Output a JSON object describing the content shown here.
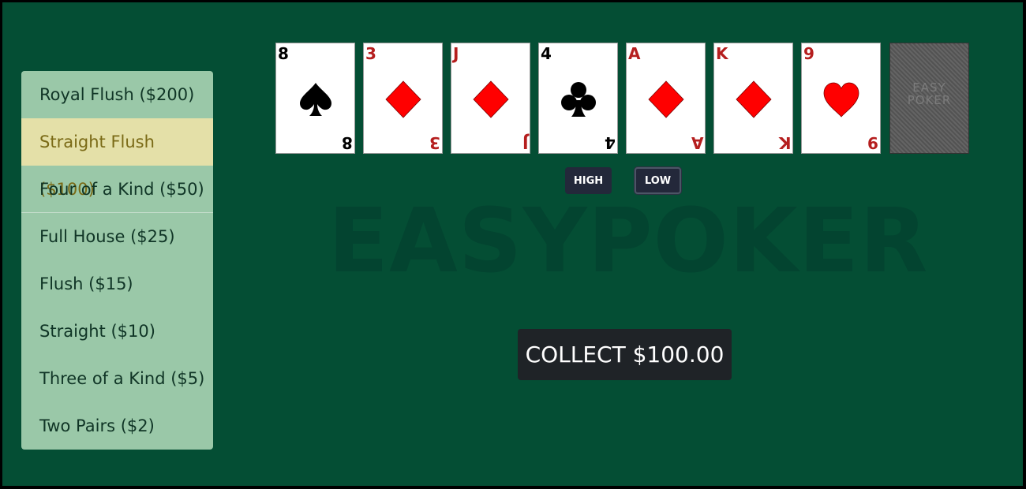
{
  "pay_table": [
    {
      "label": "Royal Flush ($200)",
      "active": false
    },
    {
      "label": "Straight Flush ($100)",
      "active": true
    },
    {
      "label": "Four of a Kind ($50)",
      "active": false
    },
    {
      "label": "Full House ($25)",
      "active": false
    },
    {
      "label": "Flush ($15)",
      "active": false
    },
    {
      "label": "Straight ($10)",
      "active": false
    },
    {
      "label": "Three of a Kind ($5)",
      "active": false
    },
    {
      "label": "Two Pairs ($2)",
      "active": false
    }
  ],
  "cards": [
    {
      "rank": "8",
      "suit": "spade"
    },
    {
      "rank": "3",
      "suit": "diamond"
    },
    {
      "rank": "J",
      "suit": "diamond"
    },
    {
      "rank": "4",
      "suit": "club"
    },
    {
      "rank": "A",
      "suit": "diamond"
    },
    {
      "rank": "K",
      "suit": "diamond"
    },
    {
      "rank": "9",
      "suit": "heart"
    }
  ],
  "deck": {
    "line1": "EASY",
    "line2": "POKER"
  },
  "buttons": {
    "high": "HIGH",
    "low": "LOW",
    "collect": "COLLECT $100.00"
  },
  "watermark": "EASYPOKER",
  "colors": {
    "felt": "#044e34",
    "pay_bg": "#9ac8a8",
    "pay_active": "#e4e0a8",
    "red": "#ff0000",
    "button_dark": "#1f2327"
  }
}
